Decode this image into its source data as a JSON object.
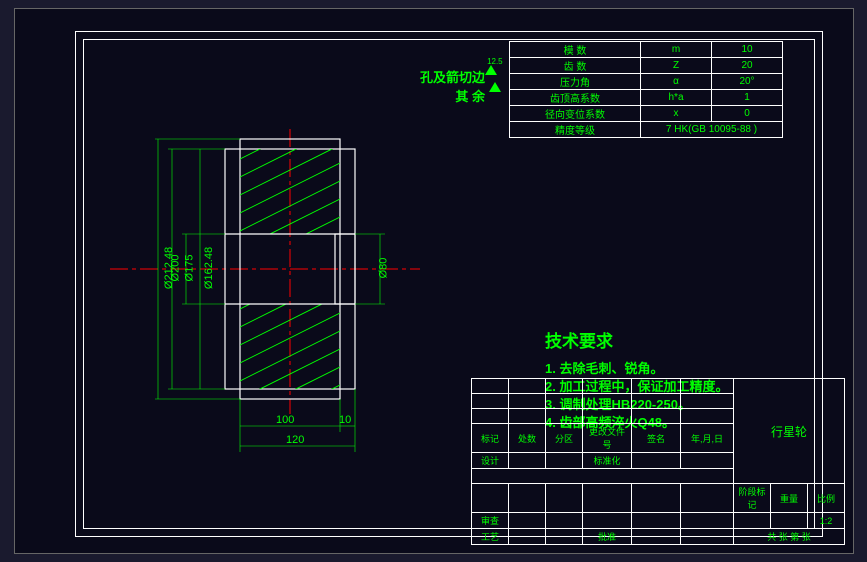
{
  "param_table": {
    "rows": [
      {
        "label": "模  数",
        "sym": "m",
        "val": "10"
      },
      {
        "label": "齿  数",
        "sym": "Z",
        "val": "20"
      },
      {
        "label": "压力角",
        "sym": "α",
        "val": "20°"
      },
      {
        "label": "齿顶高系数",
        "sym": "h*a",
        "val": "1"
      },
      {
        "label": "径向变位系数",
        "sym": "x",
        "val": "0"
      },
      {
        "label": "精度等级",
        "sym": "",
        "val": "7 HK(GB 10095-88 )"
      }
    ]
  },
  "surface_note": {
    "line1": "孔及箭切边",
    "line2": "其  余",
    "rough1": "12.5",
    "rough2": ""
  },
  "tech_req": {
    "title": "技术要求",
    "items": [
      "1. 去除毛刺、锐角。",
      "2. 加工过程中，保证加工精度。",
      "3. 调制处理HB220-250。",
      "4. 齿部高频淬火Q48。"
    ]
  },
  "title_block": {
    "r4": [
      "标记",
      "处数",
      "分区",
      "更改文件号",
      "签名",
      "年,月,日"
    ],
    "r5": [
      "设计",
      "",
      "",
      "标准化",
      "",
      ""
    ],
    "r5r": [
      "阶段标记",
      "重量",
      "比例"
    ],
    "r6r": [
      "",
      "",
      "1:2"
    ],
    "r7": [
      "审查",
      "",
      "",
      "",
      ""
    ],
    "r8": [
      "工艺",
      "",
      "",
      "批准",
      ""
    ],
    "r8r": [
      "共  张  第  张"
    ],
    "part": "行星轮"
  },
  "dims": {
    "d1": "Ø212.48",
    "d2": "Ø200",
    "d3": "Ø175",
    "d4": "Ø162.48",
    "d5": "Ø80",
    "w1": "100",
    "w2": "10",
    "w3": "120"
  }
}
